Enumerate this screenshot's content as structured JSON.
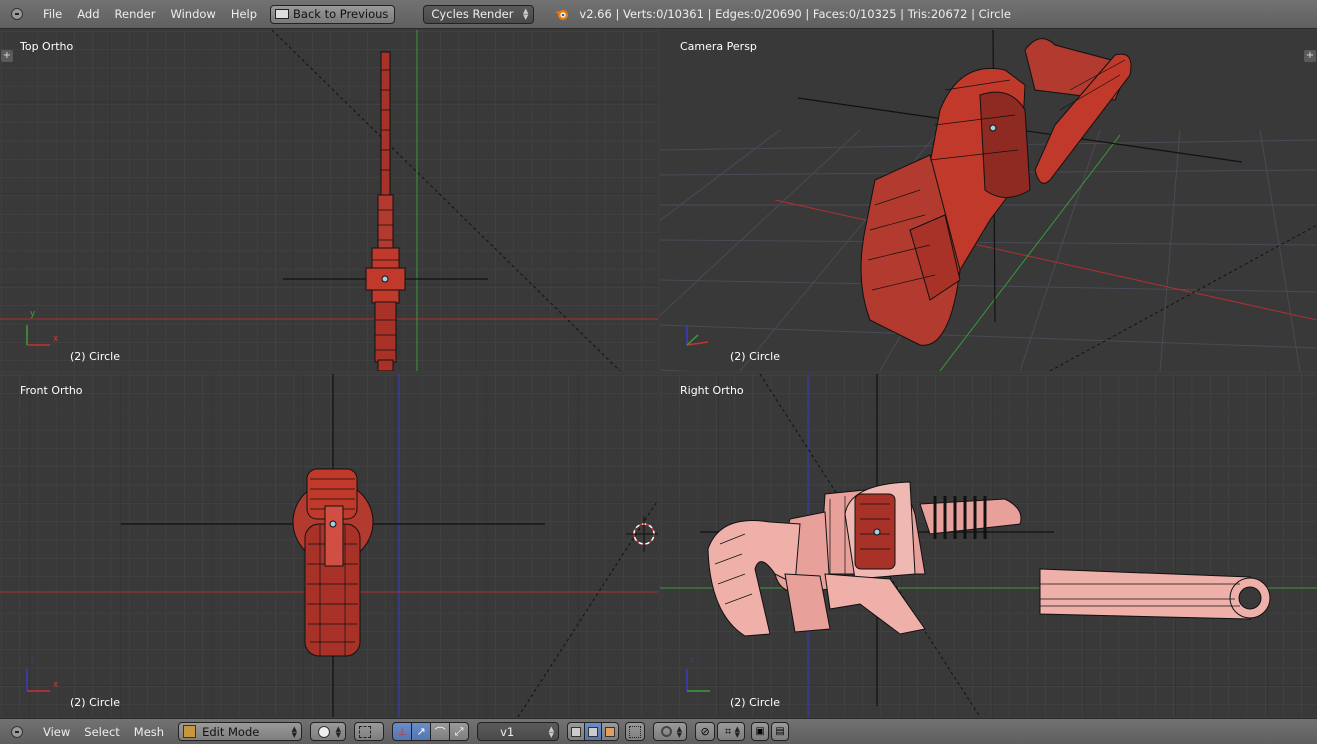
{
  "topbar": {
    "menus": [
      "File",
      "Add",
      "Render",
      "Window",
      "Help"
    ],
    "back_button": "Back to Previous",
    "render_engine": "Cycles Render",
    "stats": "v2.66 | Verts:0/10361 | Edges:0/20690 | Faces:0/10325 | Tris:20672 | Circle"
  },
  "viewports": {
    "top": {
      "label": "Top Ortho",
      "object": "(2) Circle"
    },
    "camera": {
      "label": "Camera Persp",
      "object": "(2) Circle"
    },
    "front": {
      "label": "Front Ortho",
      "object": "(2) Circle"
    },
    "right": {
      "label": "Right Ortho",
      "object": "(2) Circle"
    }
  },
  "axes": {
    "x": "x",
    "y": "y",
    "z": "z"
  },
  "bottombar": {
    "menus": [
      "View",
      "Select",
      "Mesh"
    ],
    "mode": "Edit Mode",
    "layer_field": "v1"
  },
  "colors": {
    "viewport_bg": "#393939",
    "grid": "#4a4a4a",
    "mesh_fill": "#c0392b",
    "mesh_fill_light": "#e8a09a",
    "axis_x": "#c83232",
    "axis_y": "#3c9a3c",
    "axis_z": "#3a3ac8"
  },
  "icons": [
    "collapse-icon",
    "back-icon",
    "blender-logo-icon",
    "edit-mode-icon",
    "shading-icon",
    "pivot-icon",
    "manipulator-icon",
    "layer-icon",
    "snap-icon",
    "render-icon"
  ]
}
